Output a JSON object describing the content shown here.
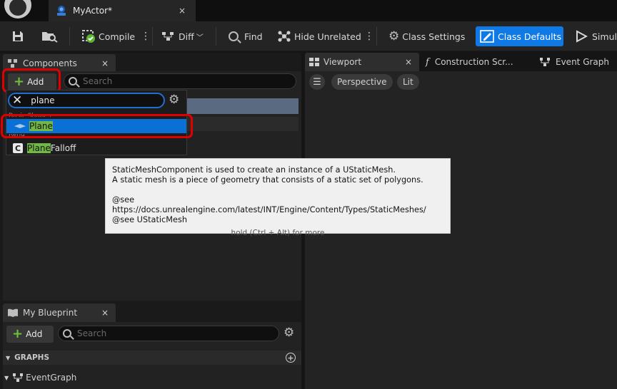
{
  "window": {
    "document_tab": "MyActor*",
    "close_glyph": "×"
  },
  "toolbar": {
    "compile": "Compile",
    "diff": "Diff",
    "find": "Find",
    "hide_unrelated": "Hide Unrelated",
    "class_settings": "Class Settings",
    "class_defaults": "Class Defaults",
    "simulate": "Simula"
  },
  "components_panel": {
    "title": "Components",
    "add_label": "Add",
    "search_placeholder": "Search"
  },
  "add_dropdown": {
    "search_value": "plane",
    "category_basic": "Basic Shapes",
    "category_rest": "Rend",
    "results": [
      {
        "match": "Plane",
        "rest": ""
      },
      {
        "match": "Plane",
        "rest": " Falloff"
      }
    ]
  },
  "tooltip": {
    "line1": "StaticMeshComponent is used to create an instance of a UStaticMesh.",
    "line2": "A static mesh is a piece of geometry that consists of a static set of polygons.",
    "line3": "@see https://docs.unrealengine.com/latest/INT/Engine/Content/Types/StaticMeshes/",
    "line4": "@see UStaticMesh",
    "hint": "hold (Ctrl + Alt) for more"
  },
  "right_tabs": {
    "viewport": "Viewport",
    "construction": "Construction Scr...",
    "event_graph": "Event Graph"
  },
  "viewport": {
    "perspective": "Perspective",
    "lit": "Lit"
  },
  "blueprint_panel": {
    "title": "My Blueprint",
    "add_label": "Add",
    "search_placeholder": "Search",
    "graphs_header": "GRAPHS",
    "event_graph": "EventGraph"
  },
  "colors": {
    "accent_blue": "#0f7ae5",
    "selection_blue": "#0a70d6",
    "match_green": "#72b845",
    "highlight_red": "#e00000"
  }
}
